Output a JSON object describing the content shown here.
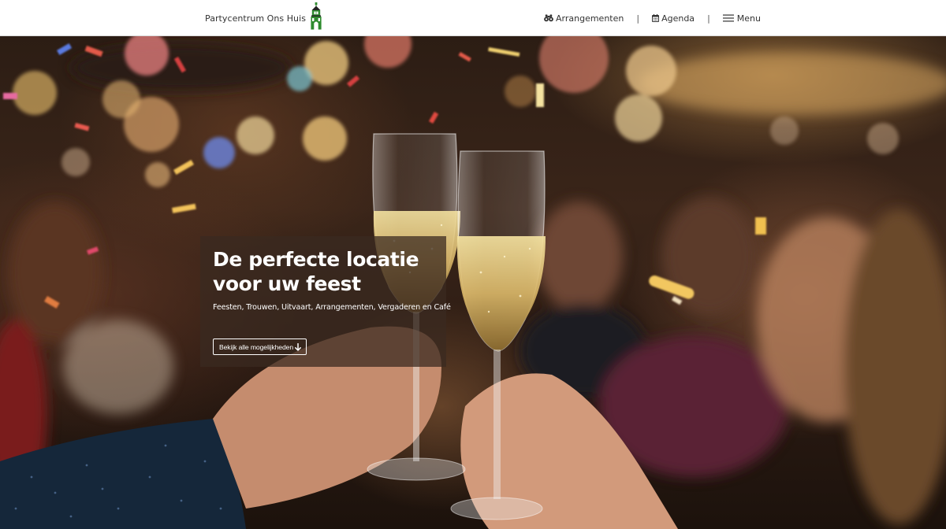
{
  "header": {
    "brand_name": "Partycentrum Ons Huis",
    "logo_icon": "green-tower-icon",
    "nav": [
      {
        "label": "Arrangementen",
        "icon": "binoculars-icon"
      },
      {
        "label": "Agenda",
        "icon": "calendar-icon"
      },
      {
        "label": "Menu",
        "icon": "hamburger-icon"
      }
    ],
    "separator": "|"
  },
  "hero": {
    "title_line1": "De perfecte locatie",
    "title_line2": "voor uw feest",
    "subtitle": "Feesten, Trouwen, Uitvaart, Arrangementen, Vergaderen en Café",
    "cta_label": "Bekijk alle mogelijkheden",
    "cta_icon": "arrow-down-icon",
    "background": "champagne-toast-photo"
  },
  "colors": {
    "header_bg": "#ffffff",
    "text": "#333333",
    "logo_green": "#2e8b2e",
    "panel_bg": "rgba(58,42,32,0.74)"
  }
}
